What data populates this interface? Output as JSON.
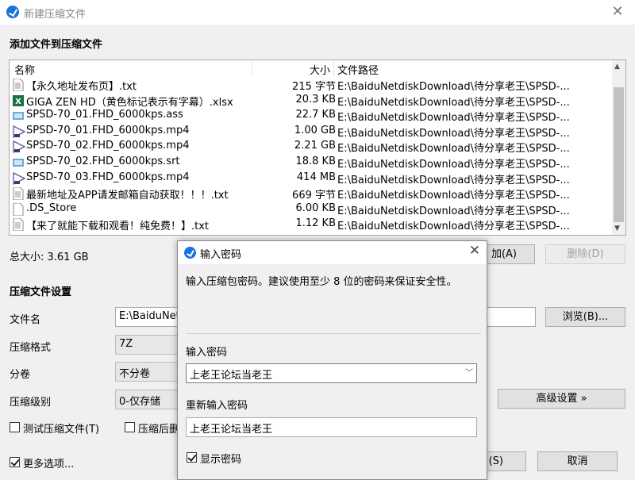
{
  "window": {
    "title": "新建压缩文件"
  },
  "file_section": {
    "title": "添加文件到压缩文件",
    "headers": {
      "name": "名称",
      "size": "大小",
      "path": "文件路径"
    },
    "files": [
      {
        "icon": "text-file-icon",
        "name": "【永久地址发布页】.txt",
        "size": "215 字节",
        "path": "E:\\BaiduNetdiskDownload\\待分享老王\\SPSD-..."
      },
      {
        "icon": "excel-file-icon",
        "name": "GIGA ZEN HD（黄色标记表示有字幕）.xlsx",
        "size": "20.3 KB",
        "path": "E:\\BaiduNetdiskDownload\\待分享老王\\SPSD-..."
      },
      {
        "icon": "subtitle-file-icon",
        "name": "SPSD-70_01.FHD_6000kps.ass",
        "size": "22.7 KB",
        "path": "E:\\BaiduNetdiskDownload\\待分享老王\\SPSD-..."
      },
      {
        "icon": "video-file-icon",
        "name": "SPSD-70_01.FHD_6000kps.mp4",
        "size": "1.00 GB",
        "path": "E:\\BaiduNetdiskDownload\\待分享老王\\SPSD-..."
      },
      {
        "icon": "video-file-icon",
        "name": "SPSD-70_02.FHD_6000kps.mp4",
        "size": "2.21 GB",
        "path": "E:\\BaiduNetdiskDownload\\待分享老王\\SPSD-..."
      },
      {
        "icon": "subtitle-file-icon",
        "name": "SPSD-70_02.FHD_6000kps.srt",
        "size": "18.8 KB",
        "path": "E:\\BaiduNetdiskDownload\\待分享老王\\SPSD-..."
      },
      {
        "icon": "video-file-icon",
        "name": "SPSD-70_03.FHD_6000kps.mp4",
        "size": "414 MB",
        "path": "E:\\BaiduNetdiskDownload\\待分享老王\\SPSD-..."
      },
      {
        "icon": "text-file-icon",
        "name": "最新地址及APP请发邮箱自动获取！！！.txt",
        "size": "669 字节",
        "path": "E:\\BaiduNetdiskDownload\\待分享老王\\SPSD-..."
      },
      {
        "icon": "blank-file-icon",
        "name": ".DS_Store",
        "size": "6.00 KB",
        "path": "E:\\BaiduNetdiskDownload\\待分享老王\\SPSD-..."
      },
      {
        "icon": "text-file-icon",
        "name": "【来了就能下载和观看！纯免费！】.txt",
        "size": "1.12 KB",
        "path": "E:\\BaiduNetdiskDownload\\待分享老王\\SPSD-..."
      }
    ],
    "total_label": "总大小: 3.61 GB",
    "add_button": "加(A)",
    "delete_button": "删除(D)"
  },
  "settings": {
    "title": "压缩文件设置",
    "filename_label": "文件名",
    "filename_value": "E:\\BaiduNet",
    "browse_button": "浏览(B)...",
    "format_label": "压缩格式",
    "format_value": "7Z",
    "volume_label": "分卷",
    "volume_value": "不分卷",
    "level_label": "压缩级别",
    "level_value": "0-仅存储",
    "advanced_button": "高级设置 »",
    "test_checkbox": "测试压缩文件(T)",
    "delete_after_checkbox": "压缩后删",
    "more_options": "更多选项...",
    "ok_button": "(S)",
    "cancel_button": "取消"
  },
  "password_dialog": {
    "title": "输入密码",
    "hint": "输入压缩包密码。建议使用至少 8 位的密码来保证安全性。",
    "password_label": "输入密码",
    "password_value": "上老王论坛当老王",
    "confirm_label": "重新输入密码",
    "confirm_value": "上老王论坛当老王",
    "show_password": "显示密码"
  }
}
